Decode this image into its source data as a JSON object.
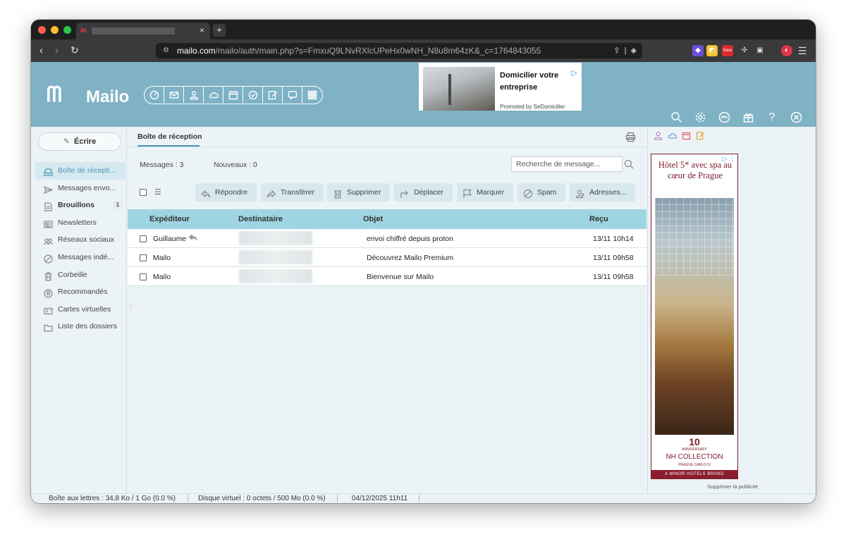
{
  "browser": {
    "url_domain": "mailo.com",
    "url_path": "/mailo/auth/main.php?s=FmxuQ9LNvRXlcUPeHx0wNH_N8u8m64zK&_c=1764843055",
    "tab_close": "×",
    "new_tab": "+"
  },
  "header": {
    "logo_text": "Mailo",
    "top_ad": {
      "title": "Domicilier votre entreprise",
      "promoted": "Promoted by SeDomicilier"
    }
  },
  "sidebar": {
    "compose_label": "Écrire",
    "items": [
      {
        "label": "Boîte de récepti...",
        "icon": "inbox-icon"
      },
      {
        "label": "Messages envo...",
        "icon": "send-icon"
      },
      {
        "label": "Brouillons",
        "icon": "draft-icon",
        "badge": "1"
      },
      {
        "label": "Newsletters",
        "icon": "newsletter-icon"
      },
      {
        "label": "Réseaux sociaux",
        "icon": "social-icon"
      },
      {
        "label": "Messages indé...",
        "icon": "ban-icon"
      },
      {
        "label": "Corbeille",
        "icon": "trash-icon"
      },
      {
        "label": "Recommandés",
        "icon": "registered-icon"
      },
      {
        "label": "Cartes virtuelles",
        "icon": "card-icon"
      },
      {
        "label": "Liste des dossiers",
        "icon": "folder-icon"
      }
    ]
  },
  "main": {
    "tab_label": "Boîte de réception",
    "messages_count": "Messages : 3",
    "new_count": "Nouveaux : 0",
    "search_placeholder": "Recherche de message...",
    "toolbar": {
      "reply": "Répondre",
      "forward": "Transférer",
      "delete": "Supprimer",
      "move": "Déplacer",
      "mark": "Marquer",
      "spam": "Spam",
      "addresses": "Adresses..."
    },
    "columns": {
      "from": "Expéditeur",
      "to": "Destinataire",
      "subject": "Objet",
      "received": "Reçu"
    },
    "rows": [
      {
        "from": "Guillaume",
        "subject": "envoi chiffré depuis proton",
        "date": "13/11 10h14",
        "replied": true
      },
      {
        "from": "Mailo",
        "subject": "Découvrez Mailo Premium",
        "date": "13/11 09h58",
        "replied": false
      },
      {
        "from": "Mailo",
        "subject": "Bienvenue sur Mailo",
        "date": "13/11 09h58",
        "replied": false
      }
    ]
  },
  "side_ad": {
    "headline": "Hôtel 5* avec spa au cœur de Prague",
    "anniversary": "10",
    "anniversary_sub": "ANNIVERSARY",
    "brand": "NH COLLECTION",
    "location": "PRAGUE CARLO IV",
    "band": "A MINOR HOTELS BRAND",
    "remove_ads": "Supprimer la publicité"
  },
  "status": {
    "mailbox": "Boîte aux lettres : 34,8 Ko / 1 Go (0.0 %)",
    "disk": "Disque virtuel : 0 octets / 500 Mo (0.0 %)",
    "datetime": "04/12/2025 11h11"
  },
  "colors": {
    "header": "#7fb2c4",
    "accent": "#4a94b5",
    "table_header": "#9fd4e3"
  }
}
